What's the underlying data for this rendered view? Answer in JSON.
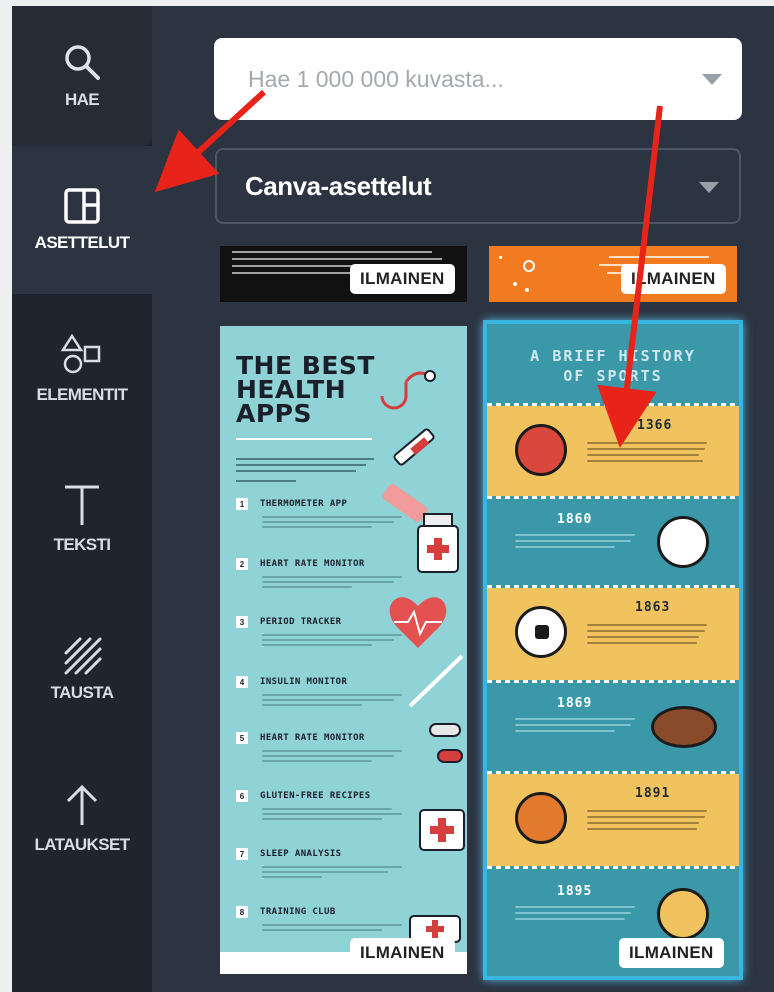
{
  "sidebar": {
    "items": [
      {
        "label": "HAE",
        "icon": "search-icon"
      },
      {
        "label": "ASETTELUT",
        "icon": "layout-icon",
        "active": true
      },
      {
        "label": "ELEMENTIT",
        "icon": "shapes-icon"
      },
      {
        "label": "TEKSTI",
        "icon": "text-icon"
      },
      {
        "label": "TAUSTA",
        "icon": "background-pattern-icon"
      },
      {
        "label": "LATAUKSET",
        "icon": "upload-arrow-icon"
      }
    ]
  },
  "search": {
    "placeholder": "Hae 1 000 000 kuvasta...",
    "value": ""
  },
  "layout_filter": {
    "selected": "Canva-asettelut"
  },
  "templates": [
    {
      "badge": "ILMAINEN"
    },
    {
      "badge": "ILMAINEN"
    },
    {
      "badge": "ILMAINEN",
      "title_lines": [
        "THE BEST",
        "HEALTH",
        "APPS"
      ],
      "items": [
        {
          "num": "1",
          "title": "THERMOMETER APP"
        },
        {
          "num": "2",
          "title": "HEART RATE MONITOR"
        },
        {
          "num": "3",
          "title": "PERIOD TRACKER"
        },
        {
          "num": "4",
          "title": "INSULIN MONITOR"
        },
        {
          "num": "5",
          "title": "HEART RATE MONITOR"
        },
        {
          "num": "6",
          "title": "GLUTEN-FREE RECIPES"
        },
        {
          "num": "7",
          "title": "SLEEP ANALYSIS"
        },
        {
          "num": "8",
          "title": "TRAINING CLUB"
        }
      ]
    },
    {
      "badge": "ILMAINEN",
      "title_lines": [
        "A BRIEF HISTORY",
        "OF SPORTS"
      ],
      "years": [
        "1366",
        "1860",
        "1863",
        "1869",
        "1891",
        "1895"
      ]
    }
  ],
  "colors": {
    "sidebar_bg": "#1f242e",
    "panel_bg": "#2c3341",
    "annotation_arrow": "#e8231a",
    "selection_glow": "#39b6e0"
  }
}
